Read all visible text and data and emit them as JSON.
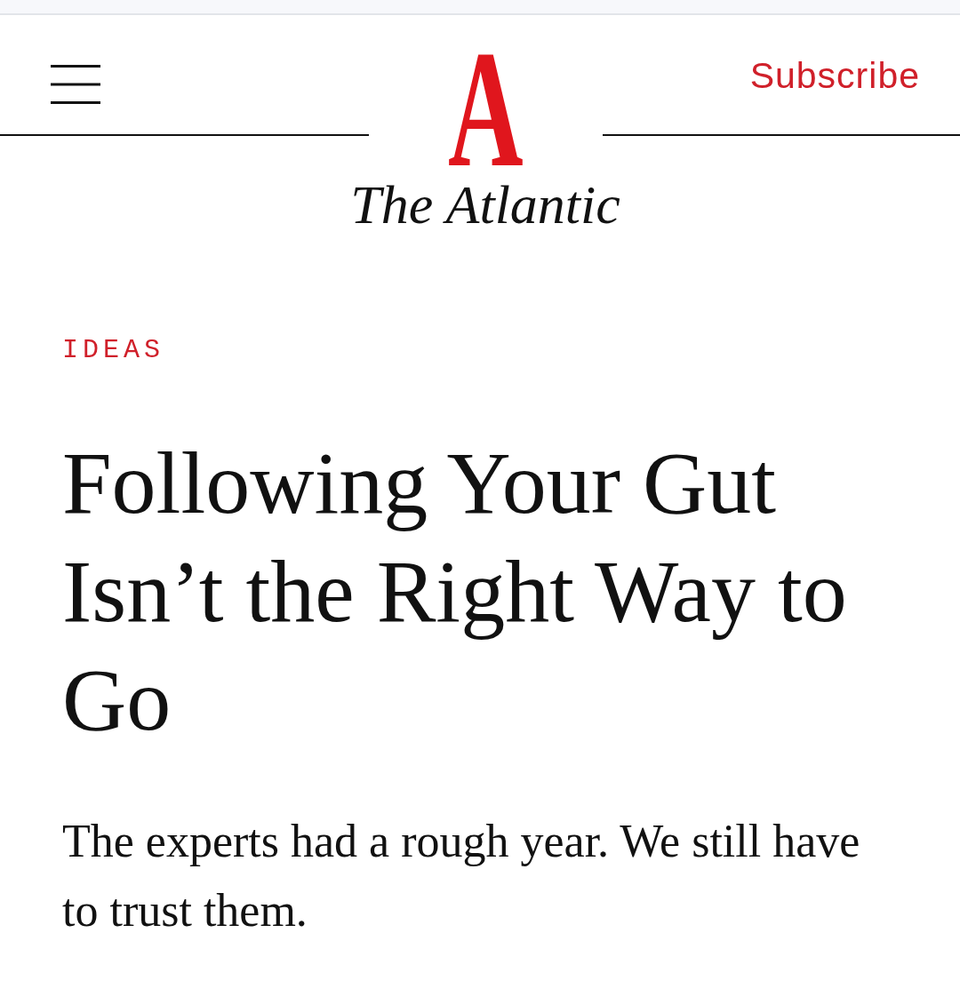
{
  "header": {
    "subscribe": "Subscribe"
  },
  "logo": {
    "mark": "A",
    "wordmark": "The Atlantic"
  },
  "article": {
    "section": "IDEAS",
    "headline": "Following Your Gut Isn’t the Right Way to Go",
    "dek": "The experts had a rough year. We still have to trust them."
  }
}
